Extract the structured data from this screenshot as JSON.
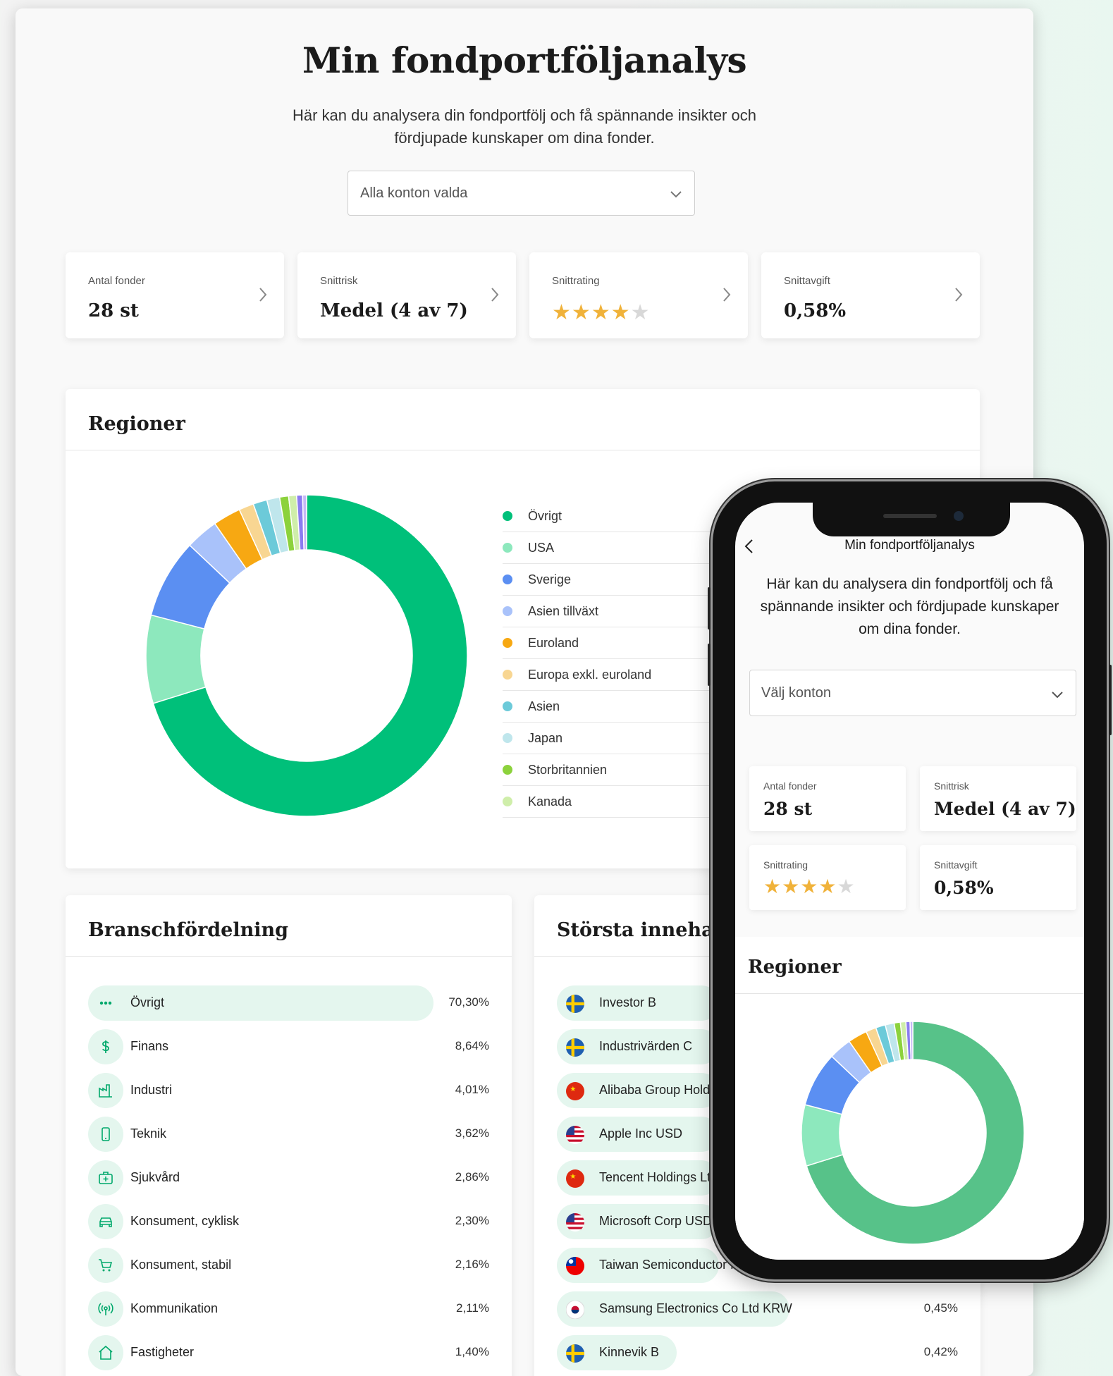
{
  "desktop": {
    "title": "Min fondportföljanalys",
    "intro": "Här kan du analysera din fondportfölj och få spännande insikter och fördjupade kunskaper om dina fonder.",
    "account_select": "Alla konton valda",
    "stats": [
      {
        "label": "Antal fonder",
        "value": "28 st"
      },
      {
        "label": "Snittrisk",
        "value": "Medel (4 av 7)"
      },
      {
        "label": "Snittrating",
        "rating": 4,
        "max": 5
      },
      {
        "label": "Snittavgift",
        "value": "0,58%"
      }
    ],
    "regions": {
      "heading": "Regioner",
      "legend": [
        {
          "name": "Övrigt",
          "color": "#00c07a"
        },
        {
          "name": "USA",
          "color": "#8de8bd"
        },
        {
          "name": "Sverige",
          "color": "#5b8ff2"
        },
        {
          "name": "Asien tillväxt",
          "color": "#a9c2fa"
        },
        {
          "name": "Euroland",
          "color": "#f7a812"
        },
        {
          "name": "Europa exkl. euroland",
          "color": "#f8d692"
        },
        {
          "name": "Asien",
          "color": "#6ccad9"
        },
        {
          "name": "Japan",
          "color": "#bfe6ec"
        },
        {
          "name": "Storbritannien",
          "color": "#8cd23c"
        },
        {
          "name": "Kanada",
          "color": "#cfeeaa"
        }
      ]
    },
    "branches": {
      "heading": "Branschfördelning",
      "items": [
        {
          "name": "Övrigt",
          "pct": "70,30%",
          "icon": "dots-icon"
        },
        {
          "name": "Finans",
          "pct": "8,64%",
          "icon": "dollar-icon"
        },
        {
          "name": "Industri",
          "pct": "4,01%",
          "icon": "factory-icon"
        },
        {
          "name": "Teknik",
          "pct": "3,62%",
          "icon": "phone-icon"
        },
        {
          "name": "Sjukvård",
          "pct": "2,86%",
          "icon": "medical-kit-icon"
        },
        {
          "name": "Konsument, cyklisk",
          "pct": "2,30%",
          "icon": "car-icon"
        },
        {
          "name": "Konsument, stabil",
          "pct": "2,16%",
          "icon": "cart-icon"
        },
        {
          "name": "Kommunikation",
          "pct": "2,11%",
          "icon": "antenna-icon"
        },
        {
          "name": "Fastigheter",
          "pct": "1,40%",
          "icon": "house-icon"
        }
      ]
    },
    "holdings": {
      "heading": "Största innehav",
      "items": [
        {
          "name": "Investor B",
          "pct": "",
          "flag": "se"
        },
        {
          "name": "Industrivärden C",
          "pct": "",
          "flag": "se"
        },
        {
          "name": "Alibaba Group Holdi",
          "pct": "",
          "flag": "cn"
        },
        {
          "name": "Apple Inc USD",
          "pct": "",
          "flag": "us"
        },
        {
          "name": "Tencent Holdings Ltd",
          "pct": "",
          "flag": "cn"
        },
        {
          "name": "Microsoft Corp USD",
          "pct": "",
          "flag": "us"
        },
        {
          "name": "Taiwan Semiconductor M",
          "pct": "",
          "flag": "tw"
        },
        {
          "name": "Samsung Electronics Co Ltd KRW",
          "pct": "0,45%",
          "flag": "kr"
        },
        {
          "name": "Kinnevik B",
          "pct": "0,42%",
          "flag": "se"
        }
      ]
    }
  },
  "phone": {
    "nav_title": "Min fondportföljanalys",
    "intro": "Här kan du analysera din fondportfölj och få spännande insikter och fördjupade kunskaper om dina fonder.",
    "account_select": "Välj konton",
    "stats": [
      {
        "label": "Antal fonder",
        "value": "28 st"
      },
      {
        "label": "Snittrisk",
        "value": "Medel (4 av 7)"
      },
      {
        "label": "Snittrating",
        "rating": 4,
        "max": 5
      },
      {
        "label": "Snittavgift",
        "value": "0,58%"
      }
    ],
    "regions_heading": "Regioner",
    "donut_main_color": "#57c289"
  },
  "chart_data": {
    "type": "pie",
    "categories": [
      "Övrigt",
      "USA",
      "Sverige",
      "Asien tillväxt",
      "Euroland",
      "Europa exkl. euroland",
      "Asien",
      "Japan",
      "Storbritannien",
      "Kanada",
      "",
      ""
    ],
    "values": [
      70.4,
      8.9,
      8.0,
      3.3,
      2.8,
      1.5,
      1.4,
      1.3,
      0.9,
      0.8,
      0.6,
      0.4
    ],
    "colors": [
      "#00c07a",
      "#8de8bd",
      "#5b8ff2",
      "#a9c2fa",
      "#f7a812",
      "#f8d692",
      "#6ccad9",
      "#bfe6ec",
      "#8cd23c",
      "#cfeeaa",
      "#8b7cf0",
      "#c6b8f6"
    ],
    "legend": "right"
  }
}
